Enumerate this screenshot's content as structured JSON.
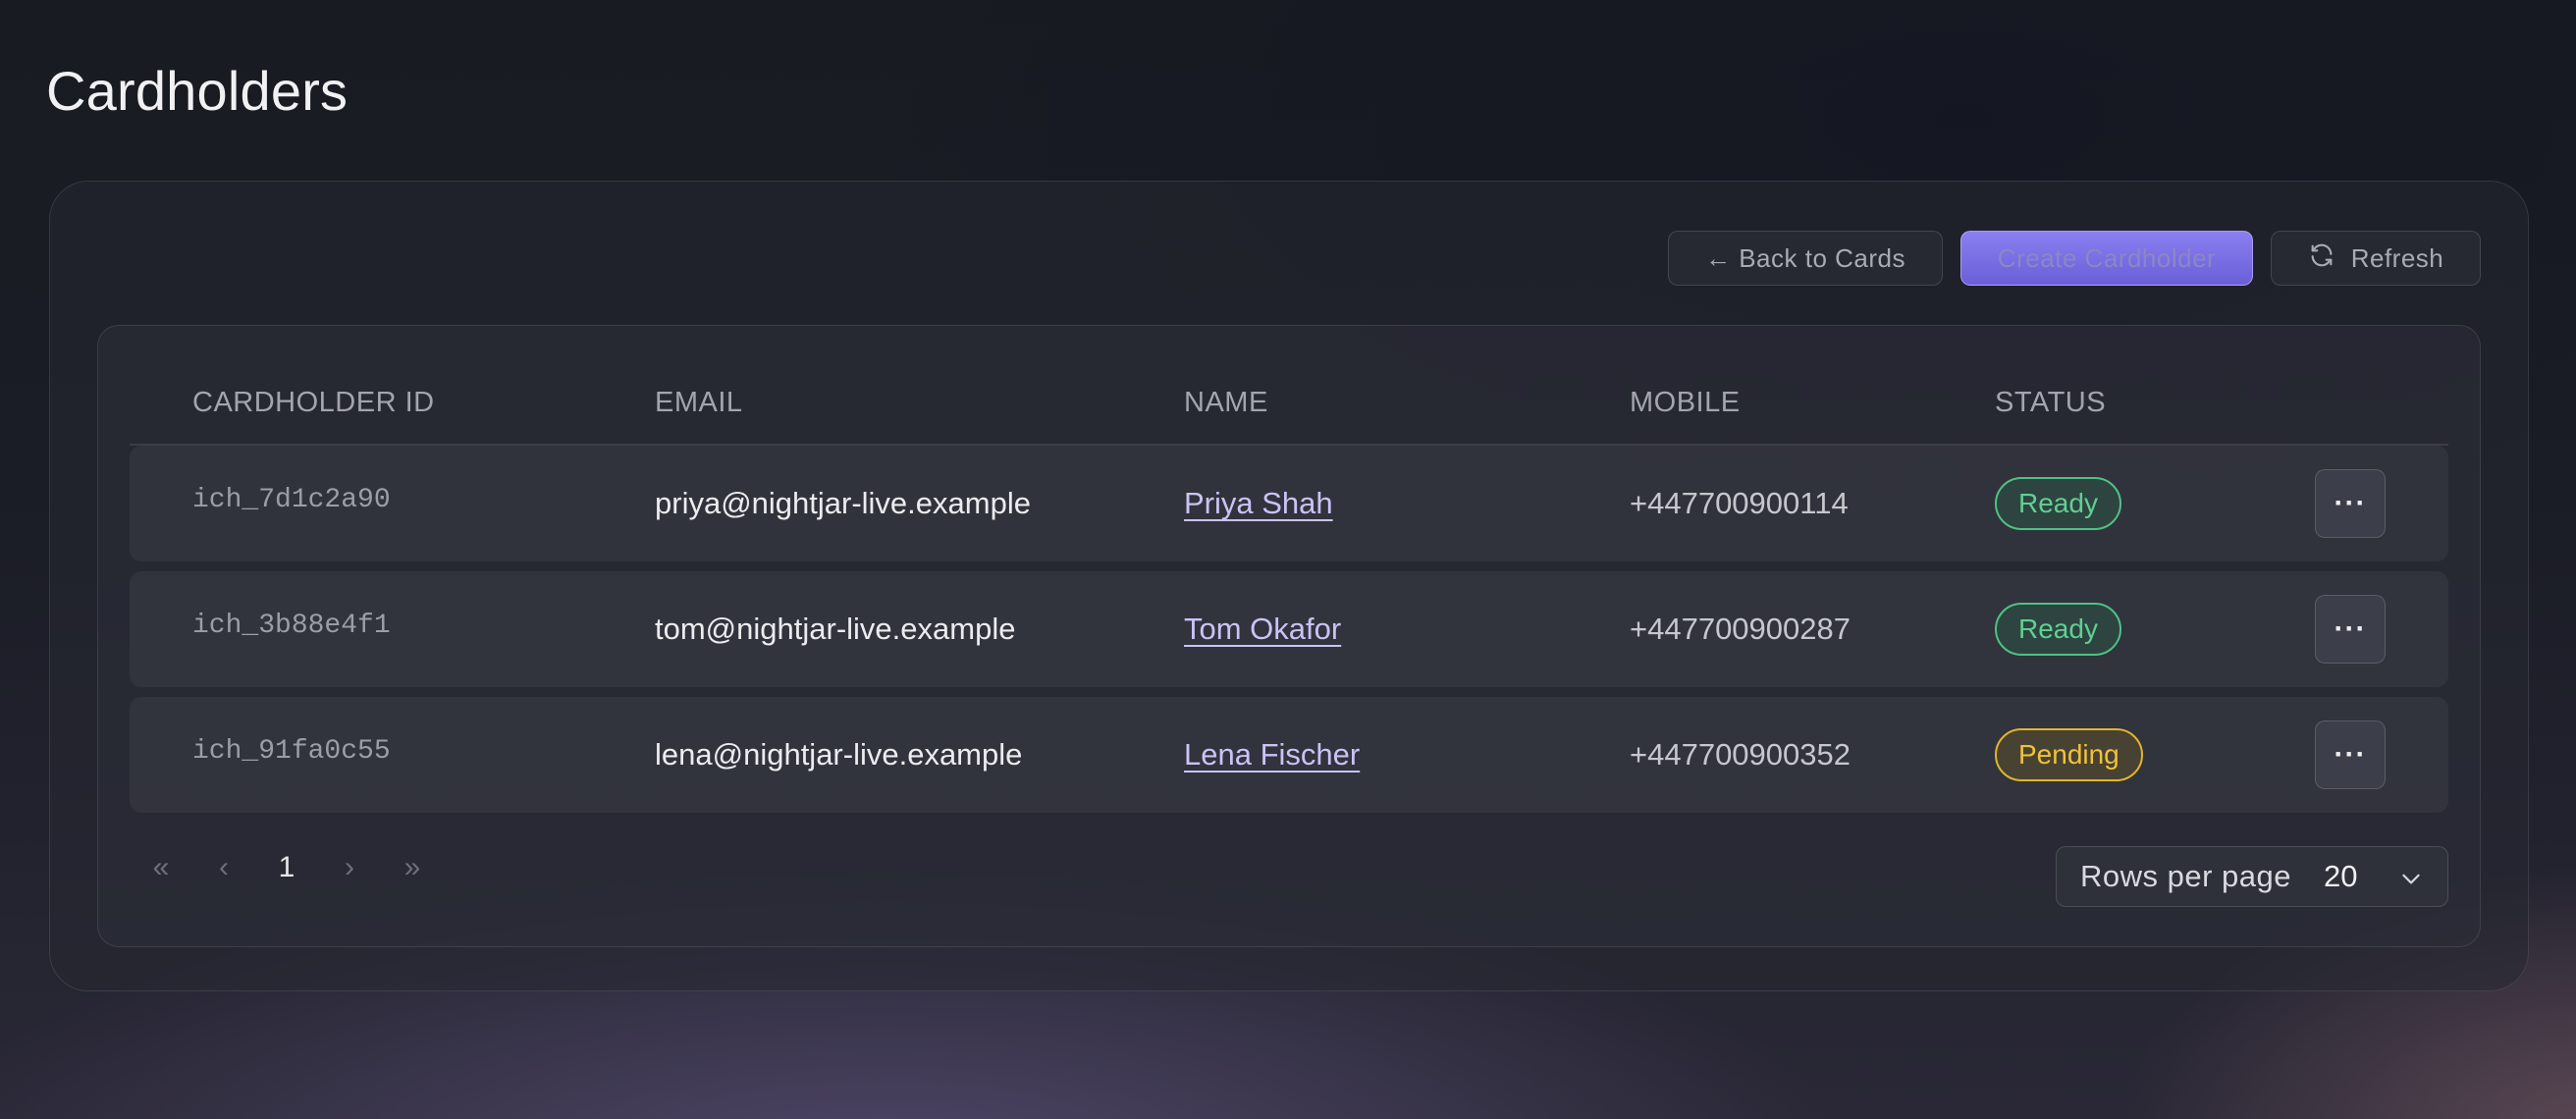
{
  "page": {
    "title": "Cardholders"
  },
  "toolbar": {
    "back_label": "← Back to Cards",
    "create_label": "Create Cardholder",
    "refresh_label": "Refresh",
    "refresh_icon": "refresh-icon"
  },
  "table": {
    "columns": [
      "Cardholder ID",
      "Email",
      "Name",
      "Mobile",
      "Status"
    ],
    "rows": [
      {
        "id": "ich_7d1c2a90",
        "email": "priya@nightjar-live.example",
        "name": "Priya Shah",
        "mobile": "+447700900114",
        "status": "Ready"
      },
      {
        "id": "ich_3b88e4f1",
        "email": "tom@nightjar-live.example",
        "name": "Tom Okafor",
        "mobile": "+447700900287",
        "status": "Ready"
      },
      {
        "id": "ich_91fa0c55",
        "email": "lena@nightjar-live.example",
        "name": "Lena Fischer",
        "mobile": "+447700900352",
        "status": "Pending"
      }
    ],
    "row_menu_label": "···"
  },
  "pagination": {
    "first": "«",
    "prev": "‹",
    "current_page": "1",
    "next": "›",
    "last": "»",
    "rows_per_page_label": "Rows per page",
    "rows_per_page_value": "20"
  },
  "colors": {
    "accent": "#7b70e6",
    "status_ready": "#5fd092",
    "status_pending": "#f0c23a",
    "link": "#c9c3f5"
  }
}
